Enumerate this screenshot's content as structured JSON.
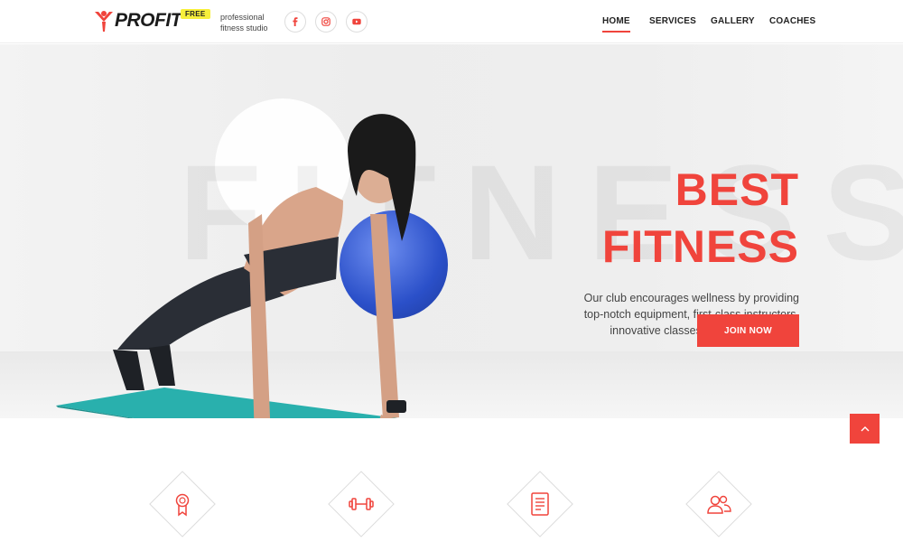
{
  "brand": {
    "logo_text": "PROFIT",
    "badge": "FREE",
    "tagline": "professional fitness studio",
    "accent_color": "#f0443c"
  },
  "social": [
    {
      "name": "facebook-icon"
    },
    {
      "name": "instagram-icon"
    },
    {
      "name": "youtube-icon"
    }
  ],
  "nav": {
    "items": [
      "HOME",
      "SERVICES",
      "GALLERY",
      "COACHES"
    ],
    "active": "HOME"
  },
  "hero": {
    "background_word": "FITNESS",
    "title_line1": "BEST",
    "title_line2": "FITNESS",
    "description": "Our club encourages wellness by providing top-notch equipment, first-class instructors, innovative classes, and qualified staff.",
    "cta_label": "JOIN NOW"
  },
  "scroll_top_icon": "chevron-up-icon",
  "features": [
    {
      "icon": "award-icon"
    },
    {
      "icon": "dumbbell-icon"
    },
    {
      "icon": "document-icon"
    },
    {
      "icon": "users-icon"
    }
  ]
}
